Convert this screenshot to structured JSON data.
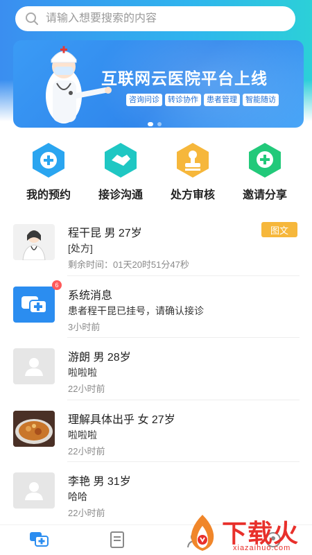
{
  "search": {
    "placeholder": "请输入想要搜索的内容"
  },
  "banner": {
    "title": "互联网云医院平台上线",
    "tags": [
      "咨询问诊",
      "转诊协作",
      "患者管理",
      "智能随访"
    ],
    "slide_count": 2,
    "active_slide": 1
  },
  "quick_actions": [
    {
      "label": "我的预约",
      "icon": "plus-shield-icon",
      "color": "#2aa5f0"
    },
    {
      "label": "接诊沟通",
      "icon": "handshake-icon",
      "color": "#1fc7c3"
    },
    {
      "label": "处方审核",
      "icon": "stamp-icon",
      "color": "#f6b73b"
    },
    {
      "label": "邀请分享",
      "icon": "plus-chat-icon",
      "color": "#22c97a"
    }
  ],
  "messages": [
    {
      "name": "程干昆 男 27岁",
      "desc": "[处方]",
      "time": "剩余时间：01天20时51分47秒",
      "tag": "图文",
      "avatar": "doctor-avatar"
    },
    {
      "name": "系统消息",
      "desc": "患者程干昆已挂号，请确认接诊",
      "time": "3小时前",
      "badge": "6",
      "avatar": "system-message-icon"
    },
    {
      "name": "游朗 男 28岁",
      "desc": "啦啦啦",
      "time": "22小时前",
      "avatar": "default-user-avatar"
    },
    {
      "name": "理解具体出乎 女 27岁",
      "desc": "啦啦啦",
      "time": "22小时前",
      "avatar": "food-photo-avatar"
    },
    {
      "name": "李艳 男 31岁",
      "desc": "哈哈",
      "time": "22小时前",
      "avatar": "default-user-avatar"
    }
  ],
  "tabbar": [
    {
      "icon": "consult-icon",
      "active": true
    },
    {
      "icon": "records-icon",
      "active": false
    },
    {
      "icon": "patients-icon",
      "active": false
    },
    {
      "icon": "profile-icon",
      "active": false
    }
  ],
  "watermark": {
    "text": "下载火",
    "sub": "xiazaihuo.com"
  },
  "colors": {
    "primary": "#2b8df0",
    "tag": "#f6b73b",
    "badge": "#ff5a5a",
    "watermark": "#e8302b"
  }
}
